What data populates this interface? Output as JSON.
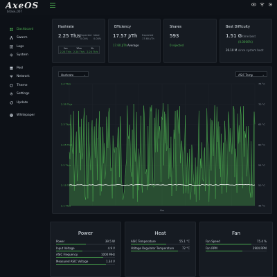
{
  "app": {
    "logo": "AxeOS",
    "subtitle": "bitaxe_007"
  },
  "sidebar": {
    "items": [
      {
        "label": "Dashboard",
        "icon": "dashboard-icon",
        "active": true
      },
      {
        "label": "Swarm",
        "icon": "sitemap-icon"
      },
      {
        "label": "Logs",
        "icon": "list-icon"
      },
      {
        "label": "System",
        "icon": "cog-icon"
      },
      {
        "label": "Pool",
        "icon": "server-icon"
      },
      {
        "label": "Network",
        "icon": "wifi-icon"
      },
      {
        "label": "Theme",
        "icon": "palette-icon"
      },
      {
        "label": "Settings",
        "icon": "cog-icon"
      },
      {
        "label": "Update",
        "icon": "refresh-icon"
      },
      {
        "label": "Whitepaper",
        "icon": "bitcoin-icon"
      }
    ]
  },
  "hashrate": {
    "title": "Hashrate",
    "value": "2.25 Th/s",
    "expected_label": "Expected",
    "expected_value": "0.00%",
    "ideal_label": "Ideal",
    "ideal_value": "0.00%",
    "table_headers": [
      "1m",
      "10m",
      "1h"
    ],
    "table_values": [
      "2.24 Th/s",
      "2.24 Th/s",
      "2.24 Th/s"
    ]
  },
  "efficiency": {
    "title": "Efficiency",
    "value": "17.57 J/Th",
    "expected_label": "Expected",
    "expected_value": "17.60 J/Th",
    "sub": "17.60 J/Th",
    "sub_label": "Average"
  },
  "shares": {
    "title": "Shares",
    "value": "593",
    "sub": "0 rejected"
  },
  "difficulty": {
    "title": "Best Difficulty",
    "value": "1.51 G",
    "value_suffix": "all-time best",
    "percent": "(0.0000%)",
    "session": "26.10 M",
    "session_suffix": "since system boot"
  },
  "chart": {
    "left_select": "Hashrate",
    "right_select": "ASIC Temp",
    "x_label": "Hrs",
    "y_left_ticks": [
      "2.4 Th/s",
      "2.35 Th/s",
      "2.3 Th/s",
      "2.25 Th/s",
      "2.2 Th/s",
      "2.15 Th/s",
      "2.1 Th/s"
    ],
    "y_right_ticks": [
      "75 °C",
      "70 °C",
      "65 °C",
      "60 °C",
      "55 °C",
      "50 °C",
      "45 °C"
    ],
    "colors": {
      "hash": "#4caf50",
      "temp": "#ffffff"
    }
  },
  "power": {
    "title": "Power",
    "rows": [
      {
        "label": "Power",
        "value": "39.5 W",
        "fill": 0.5
      },
      {
        "label": "Input Voltage",
        "value": "4.9 V",
        "fill": 0.45
      },
      {
        "label": "ASIC Frequency",
        "value": "1000 MHz",
        "fill": 0.8
      },
      {
        "label": "Measured ASIC Voltage",
        "value": "1.34 V",
        "fill": 0.85
      }
    ]
  },
  "heat": {
    "title": "Heat",
    "rows": [
      {
        "label": "ASIC Temperature",
        "value": "55.1 °C",
        "fill": 0.6
      },
      {
        "label": "Voltage Regulator Temperature",
        "value": "72 °C",
        "fill": 0.8
      }
    ]
  },
  "fan": {
    "title": "Fan",
    "rows": [
      {
        "label": "Fan Speed",
        "value": "75.4 %",
        "fill": 0.75
      },
      {
        "label": "Fan RPM",
        "value": "2904 RPM",
        "fill": 0.6
      }
    ]
  }
}
